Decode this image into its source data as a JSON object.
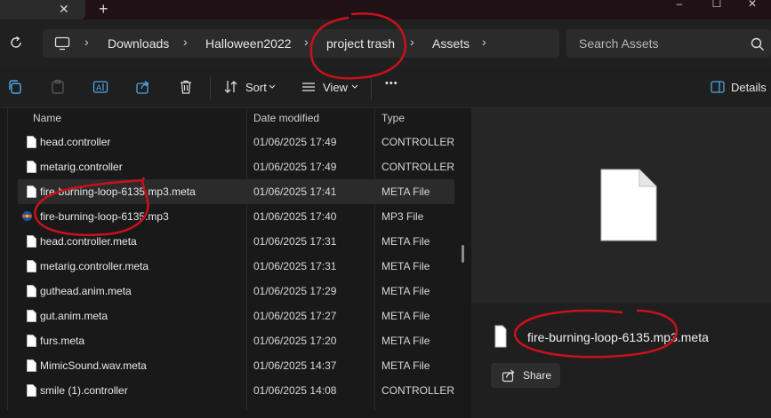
{
  "titlebar": {
    "tab_close": "✕",
    "new_tab": "+",
    "minimize": "–",
    "maximize": "☐",
    "close": "✕"
  },
  "breadcrumb": [
    "Downloads",
    "Halloween2022",
    "project trash",
    "Assets"
  ],
  "breadcrumb_sep": "›",
  "search": {
    "placeholder": "Search Assets"
  },
  "toolbar": {
    "sort_label": "Sort",
    "view_label": "View",
    "more": "•••",
    "details_label": "Details"
  },
  "columns": {
    "name": "Name",
    "date": "Date modified",
    "type": "Type"
  },
  "files": [
    {
      "name": "head.controller",
      "date": "01/06/2025 17:49",
      "type": "CONTROLLER File",
      "icon": "file-icon"
    },
    {
      "name": "metarig.controller",
      "date": "01/06/2025 17:49",
      "type": "CONTROLLER File",
      "icon": "file-icon"
    },
    {
      "name": "fire-burning-loop-6135.mp3.meta",
      "date": "01/06/2025 17:41",
      "type": "META File",
      "icon": "file-icon",
      "selected": true
    },
    {
      "name": "fire-burning-loop-6135.mp3",
      "date": "01/06/2025 17:40",
      "type": "MP3 File",
      "icon": "audio-file-icon"
    },
    {
      "name": "head.controller.meta",
      "date": "01/06/2025 17:31",
      "type": "META File",
      "icon": "file-icon"
    },
    {
      "name": "metarig.controller.meta",
      "date": "01/06/2025 17:31",
      "type": "META File",
      "icon": "file-icon"
    },
    {
      "name": "guthead.anim.meta",
      "date": "01/06/2025 17:29",
      "type": "META File",
      "icon": "file-icon"
    },
    {
      "name": "gut.anim.meta",
      "date": "01/06/2025 17:27",
      "type": "META File",
      "icon": "file-icon"
    },
    {
      "name": "furs.meta",
      "date": "01/06/2025 17:20",
      "type": "META File",
      "icon": "file-icon"
    },
    {
      "name": "MimicSound.wav.meta",
      "date": "01/06/2025 14:37",
      "type": "META File",
      "icon": "file-icon"
    },
    {
      "name": "smile (1).controller",
      "date": "01/06/2025 14:08",
      "type": "CONTROLLER File",
      "icon": "file-icon"
    }
  ],
  "details": {
    "file_name": "fire-burning-loop-6135.mp3.meta",
    "share_label": "Share"
  },
  "colors": {
    "annotation": "#c8121b",
    "background": "#191919",
    "selected_row": "#2b2b2b"
  }
}
